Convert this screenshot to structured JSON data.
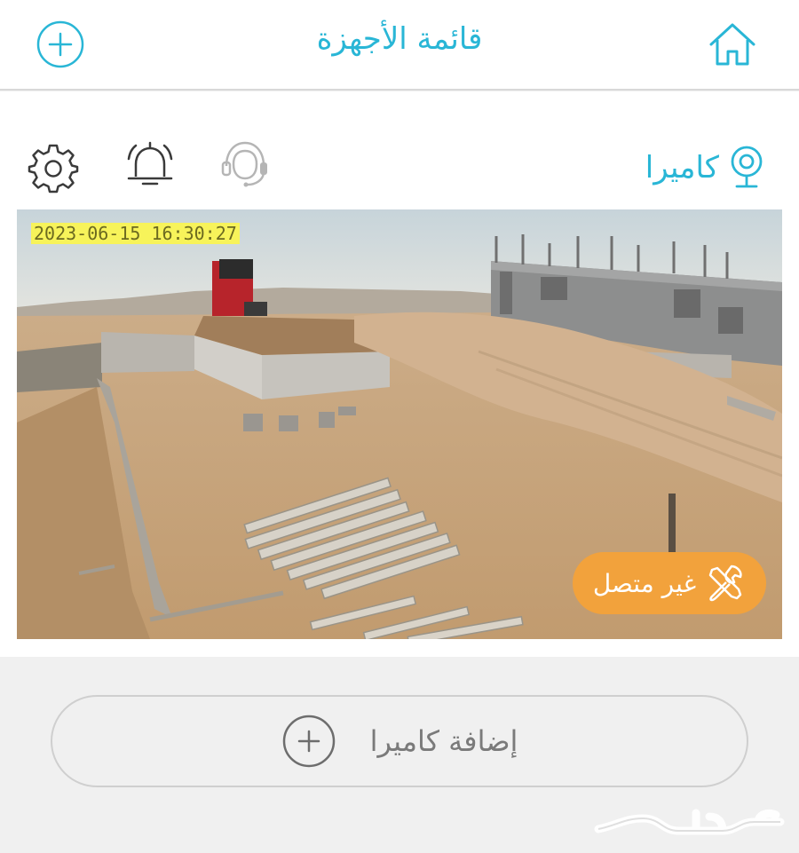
{
  "header": {
    "title": "قائمة الأجهزة",
    "add_icon": "plus-circle-icon",
    "home_icon": "home-icon"
  },
  "device": {
    "camera_label": "كاميرا",
    "camera_icon": "location-pin-icon",
    "settings_icon": "gear-icon",
    "alerts_icon": "bell-icon",
    "support_icon": "headset-icon",
    "feed": {
      "timestamp": "2023-06-15  16:30:27",
      "status_label": "غير متصل",
      "status_icon": "tools-icon"
    }
  },
  "add_camera": {
    "label": "إضافة كاميرا",
    "icon": "plus-circle-icon"
  },
  "watermark": {
    "text": "حراج"
  },
  "colors": {
    "accent": "#29b6d6",
    "offline": "#f2a23c",
    "icon_dark": "#3a3a3a",
    "icon_muted": "#b5b5b5"
  }
}
